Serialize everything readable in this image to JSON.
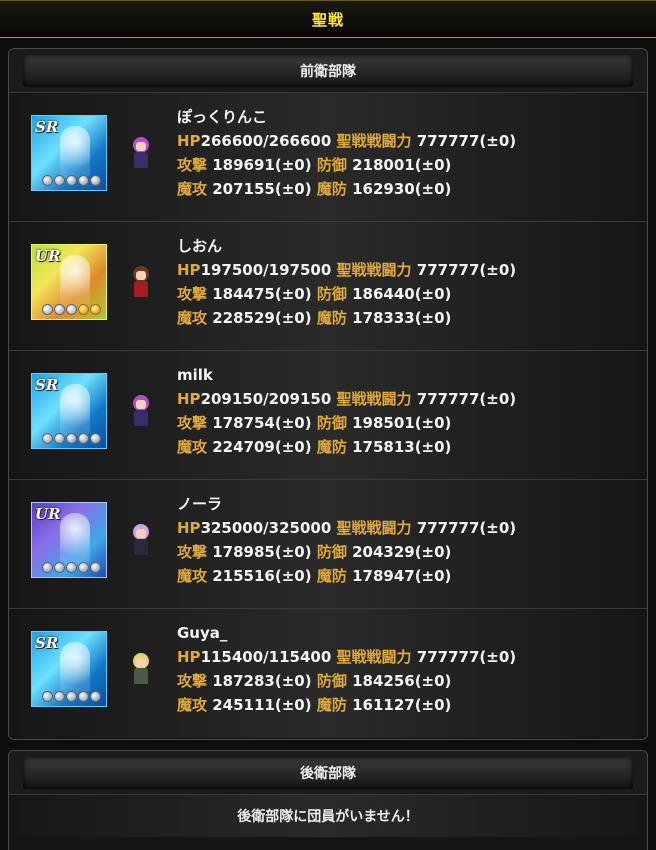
{
  "page": {
    "title": "聖戦"
  },
  "front_unit": {
    "header": "前衛部隊",
    "members": [
      {
        "name": "ぽっくりんこ",
        "rarity": "SR",
        "card_style": "sr-blue",
        "avatar": "purple",
        "hp": "266600/266600",
        "seisen_power": "777777(±0)",
        "attack": "189691(±0)",
        "defense": "218001(±0)",
        "magic_attack": "207155(±0)",
        "magic_defense": "162930(±0)"
      },
      {
        "name": "しおん",
        "rarity": "UR",
        "card_style": "ur-gold",
        "avatar": "red",
        "hp": "197500/197500",
        "seisen_power": "777777(±0)",
        "attack": "184475(±0)",
        "defense": "186440(±0)",
        "magic_attack": "228529(±0)",
        "magic_defense": "178333(±0)"
      },
      {
        "name": "milk",
        "rarity": "SR",
        "card_style": "sr-blue",
        "avatar": "purple",
        "hp": "209150/209150",
        "seisen_power": "777777(±0)",
        "attack": "178754(±0)",
        "defense": "198501(±0)",
        "magic_attack": "224709(±0)",
        "magic_defense": "175813(±0)"
      },
      {
        "name": "ノーラ",
        "rarity": "UR",
        "card_style": "ur-blue",
        "avatar": "dark",
        "hp": "325000/325000",
        "seisen_power": "777777(±0)",
        "attack": "178985(±0)",
        "defense": "204329(±0)",
        "magic_attack": "215516(±0)",
        "magic_defense": "178947(±0)"
      },
      {
        "name": "Guya_",
        "rarity": "SR",
        "card_style": "sr-blue",
        "avatar": "blonde",
        "hp": "115400/115400",
        "seisen_power": "777777(±0)",
        "attack": "187283(±0)",
        "defense": "184256(±0)",
        "magic_attack": "245111(±0)",
        "magic_defense": "161127(±0)"
      }
    ]
  },
  "labels": {
    "hp": "HP",
    "seisen_power": "聖戦戦闘力",
    "attack": "攻撃",
    "defense": "防御",
    "magic_attack": "魔攻",
    "magic_defense": "魔防"
  },
  "rear_unit": {
    "header": "後衛部隊",
    "empty_message": "後衛部隊に団員がいません！"
  },
  "colors": {
    "title": "#ffe83a",
    "stat_label": "#e0a93a",
    "text": "#f4f4f4"
  }
}
